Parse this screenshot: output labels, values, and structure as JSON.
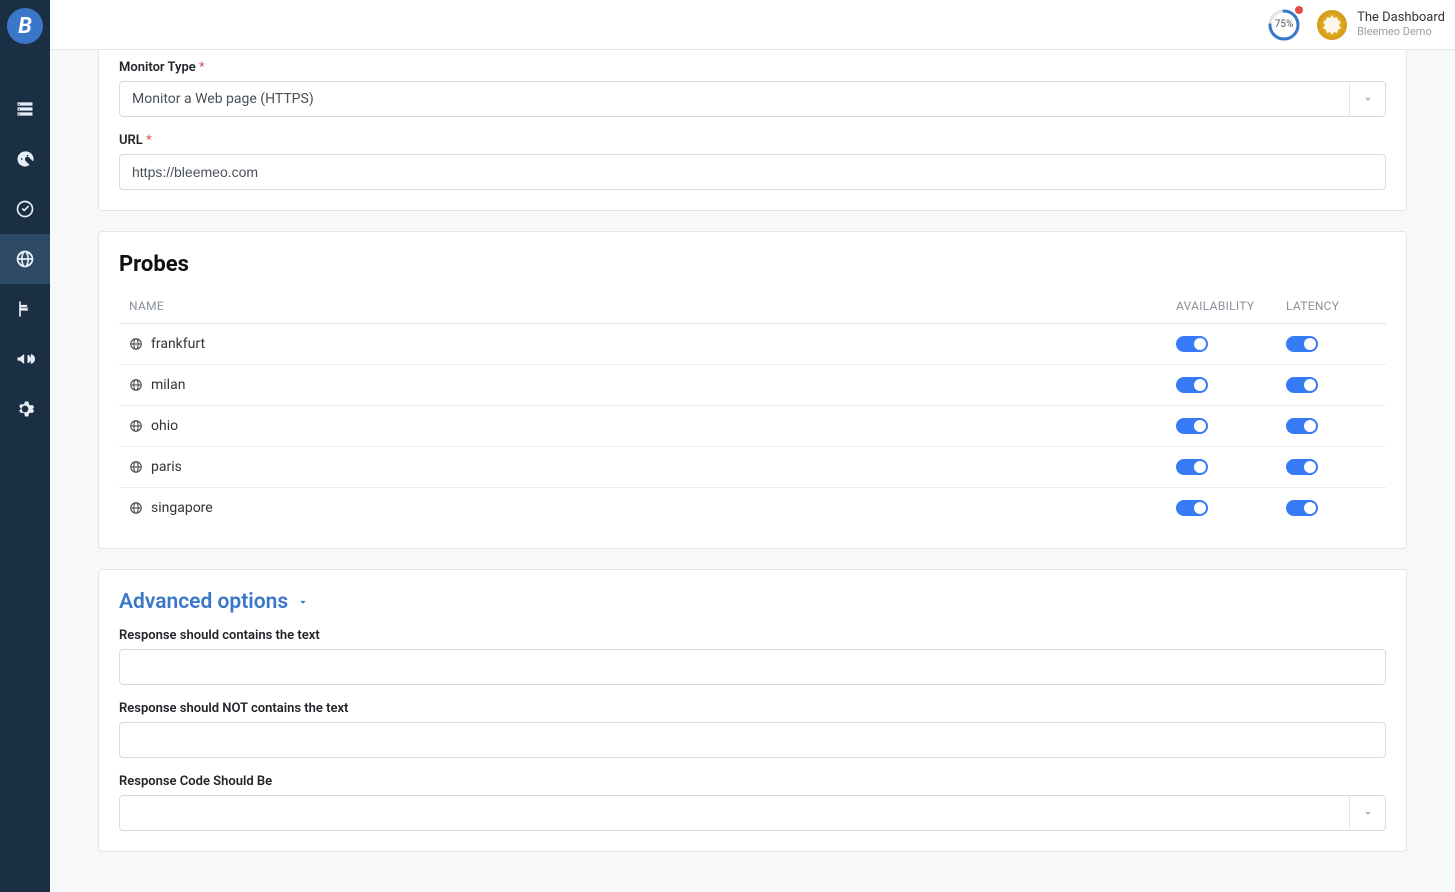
{
  "header": {
    "progress_pct": "75%",
    "title": "The Dashboard",
    "subtitle": "Bleemeo Demo"
  },
  "form": {
    "monitor_type_label": "Monitor Type",
    "monitor_type_value": "Monitor a Web page (HTTPS)",
    "url_label": "URL",
    "url_value": "https://bleemeo.com"
  },
  "probes": {
    "title": "Probes",
    "columns": {
      "name": "NAME",
      "availability": "AVAILABILITY",
      "latency": "LATENCY"
    },
    "rows": [
      {
        "name": "frankfurt",
        "availability": true,
        "latency": true
      },
      {
        "name": "milan",
        "availability": true,
        "latency": true
      },
      {
        "name": "ohio",
        "availability": true,
        "latency": true
      },
      {
        "name": "paris",
        "availability": true,
        "latency": true
      },
      {
        "name": "singapore",
        "availability": true,
        "latency": true
      }
    ]
  },
  "advanced": {
    "title": "Advanced options",
    "contains_label": "Response should contains the text",
    "contains_value": "",
    "not_contains_label": "Response should NOT contains the text",
    "not_contains_value": "",
    "code_label": "Response Code Should Be",
    "code_value": ""
  }
}
